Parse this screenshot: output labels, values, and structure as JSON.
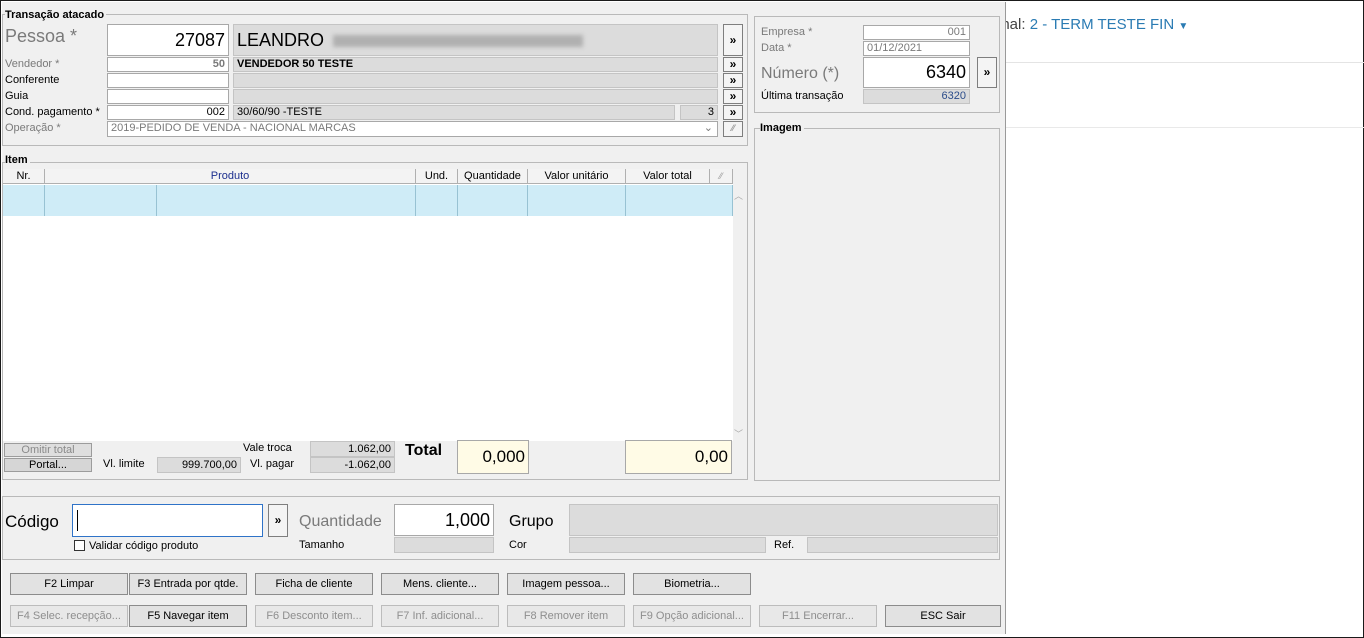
{
  "background": {
    "terminal_prefix": "inal:",
    "terminal_value": "2 - TERM TESTE FIN"
  },
  "transaction": {
    "group_title": "Transação atacado",
    "pessoa_label": "Pessoa *",
    "pessoa_code": "27087",
    "pessoa_name": "LEANDRO",
    "vendedor_label": "Vendedor *",
    "vendedor_code": "50",
    "vendedor_name": "VENDEDOR 50 TESTE",
    "conferente_label": "Conferente",
    "conferente_code": "",
    "guia_label": "Guia",
    "guia_code": "",
    "cond_label": "Cond. pagamento *",
    "cond_code": "002",
    "cond_name": "30/60/90 -TESTE",
    "cond_parcelas": "3",
    "operacao_label": "Operação *",
    "operacao_value": "2019-PEDIDO DE VENDA - NACIONAL MARCAS",
    "more": "»"
  },
  "side": {
    "empresa_label": "Empresa *",
    "empresa_value": "001",
    "data_label": "Data *",
    "data_value": "01/12/2021",
    "numero_label": "Número (*)",
    "numero_value": "6340",
    "ultima_label": "Última transação",
    "ultima_value": "6320",
    "imagem_title": "Imagem"
  },
  "items": {
    "group_title": "Item",
    "columns": {
      "nr": "Nr.",
      "produto": "Produto",
      "und": "Und.",
      "quantidade": "Quantidade",
      "valor_unitario": "Valor unitário",
      "valor_total": "Valor total"
    }
  },
  "totals": {
    "omitir_total": "Omitir total",
    "portal": "Portal...",
    "vl_limite_label": "Vl. limite",
    "vl_limite_value": "999.700,00",
    "vale_troca_label": "Vale troca",
    "vale_troca_value": "1.062,00",
    "vl_pagar_label": "Vl. pagar",
    "vl_pagar_value": "-1.062,00",
    "total_label": "Total",
    "total_qty": "0,000",
    "total_value": "0,00"
  },
  "entry": {
    "codigo_label": "Código",
    "codigo_value": "",
    "validar_label": "Validar código produto",
    "quantidade_label": "Quantidade",
    "quantidade_value": "1,000",
    "tamanho_label": "Tamanho",
    "grupo_label": "Grupo",
    "cor_label": "Cor",
    "ref_label": "Ref."
  },
  "buttons": {
    "f2": "F2 Limpar",
    "f3": "F3 Entrada por qtde.",
    "ficha": "Ficha de cliente",
    "mens": "Mens. cliente...",
    "imagem_pessoa": "Imagem pessoa...",
    "biometria": "Biometria...",
    "f4": "F4 Selec. recepção...",
    "f5": "F5 Navegar item",
    "f6": "F6 Desconto item...",
    "f7": "F7 Inf. adicional...",
    "f8": "F8 Remover item",
    "f9": "F9 Opção adicional...",
    "f11": "F11 Encerrar...",
    "esc": "ESC Sair"
  }
}
